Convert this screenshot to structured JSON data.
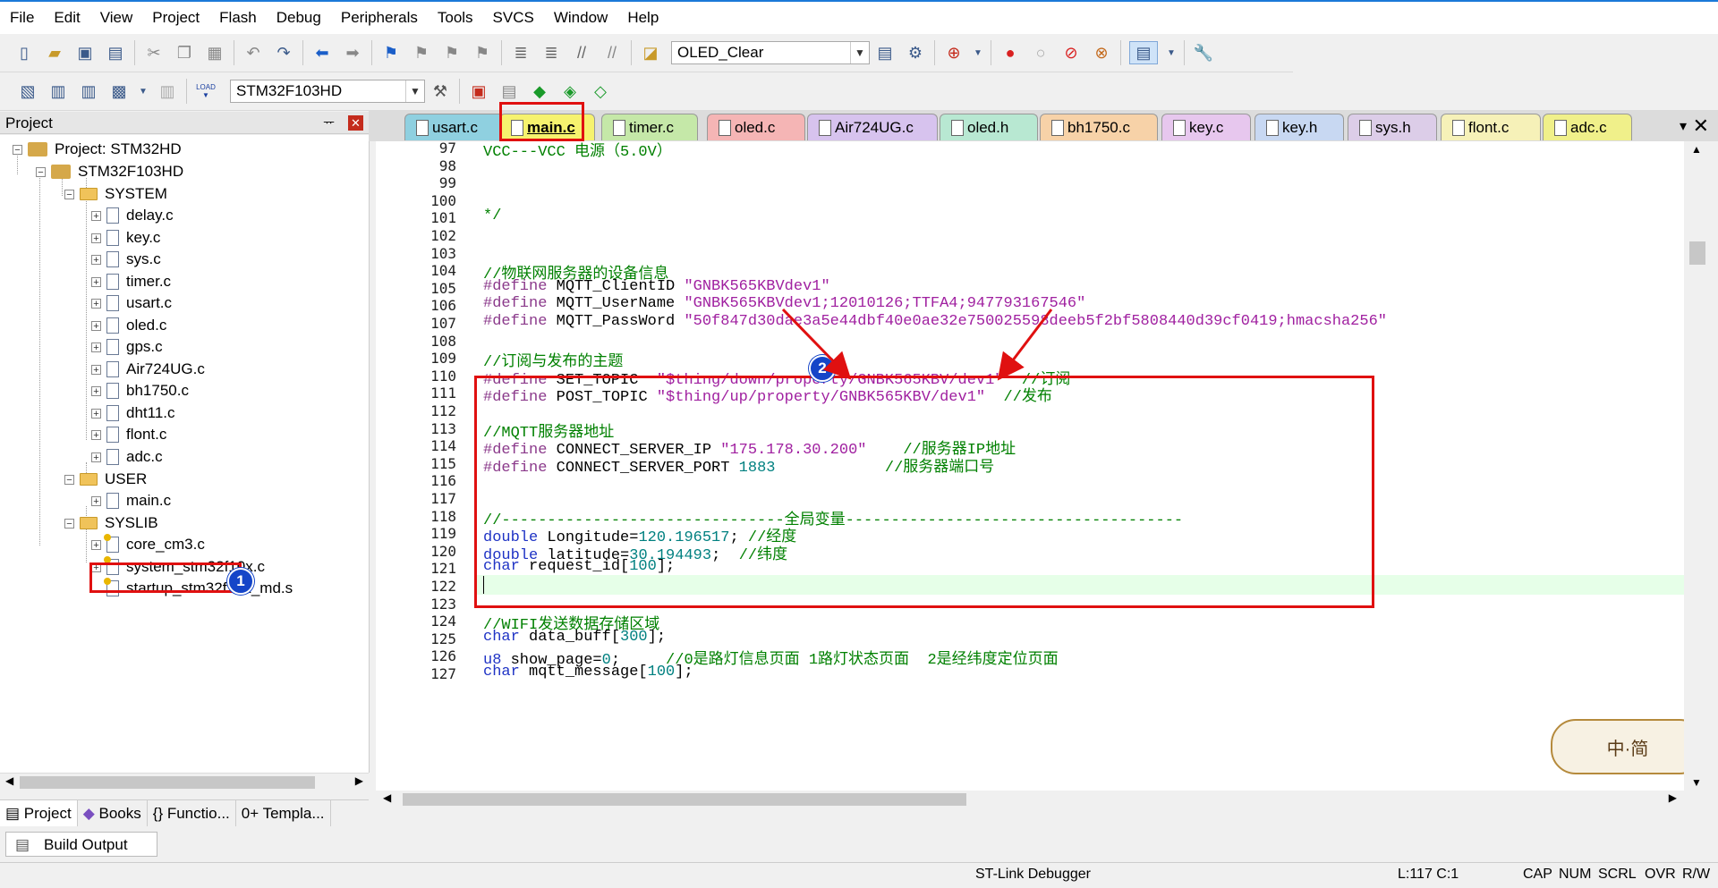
{
  "menu": [
    "File",
    "Edit",
    "View",
    "Project",
    "Flash",
    "Debug",
    "Peripherals",
    "Tools",
    "SVCS",
    "Window",
    "Help"
  ],
  "toolbar": {
    "target_combo": "OLED_Clear",
    "device_combo": "STM32F103HD",
    "load_label": "LOAD"
  },
  "project_panel": {
    "title": "Project",
    "pin": "ᅲ",
    "root": "Project: STM32HD",
    "target": "STM32F103HD",
    "groups": [
      {
        "name": "SYSTEM",
        "files": [
          "delay.c",
          "key.c",
          "sys.c",
          "timer.c",
          "usart.c",
          "oled.c",
          "gps.c",
          "Air724UG.c",
          "bh1750.c",
          "dht11.c",
          "flont.c",
          "adc.c"
        ]
      },
      {
        "name": "USER",
        "files": [
          "main.c"
        ]
      },
      {
        "name": "SYSLIB",
        "files": [
          "core_cm3.c",
          "system_stm32f10x.c",
          "startup_stm32f10x_md.s"
        ]
      }
    ],
    "tabs": [
      "Project",
      "Books",
      "{} Functio...",
      "0+ Templa..."
    ]
  },
  "editor_tabs": [
    {
      "label": "usart.c",
      "color": "#8fd0e0"
    },
    {
      "label": "main.c",
      "color": "#f6f26e"
    },
    {
      "label": "timer.c",
      "color": "#c5e8a8"
    },
    {
      "label": "oled.c",
      "color": "#f5b5b5"
    },
    {
      "label": "Air724UG.c",
      "color": "#d7c3ee"
    },
    {
      "label": "oled.h",
      "color": "#b8e8d2"
    },
    {
      "label": "bh1750.c",
      "color": "#f7d2a8"
    },
    {
      "label": "key.c",
      "color": "#e7c7ee"
    },
    {
      "label": "key.h",
      "color": "#c8d8f2"
    },
    {
      "label": "sys.h",
      "color": "#dccde8"
    },
    {
      "label": "flont.c",
      "color": "#f6f1b8"
    },
    {
      "label": "adc.c",
      "color": "#f0f08a"
    }
  ],
  "code_lines": [
    {
      "n": "97",
      "parts": [
        {
          "c": "cm",
          "t": "VCC---VCC 电源（5.0V）"
        }
      ]
    },
    {
      "n": "98",
      "parts": []
    },
    {
      "n": "99",
      "parts": []
    },
    {
      "n": "100",
      "parts": []
    },
    {
      "n": "101",
      "parts": [
        {
          "c": "cm",
          "t": "*/"
        }
      ]
    },
    {
      "n": "102",
      "parts": []
    },
    {
      "n": "103",
      "parts": []
    },
    {
      "n": "104",
      "parts": [
        {
          "c": "cm",
          "t": "//物联网服务器的设备信息"
        }
      ]
    },
    {
      "n": "105",
      "parts": [
        {
          "c": "pp",
          "t": "#define"
        },
        {
          "c": "",
          "t": " MQTT_ClientID "
        },
        {
          "c": "st",
          "t": "\"GNBK565KBVdev1\""
        }
      ]
    },
    {
      "n": "106",
      "parts": [
        {
          "c": "pp",
          "t": "#define"
        },
        {
          "c": "",
          "t": " MQTT_UserName "
        },
        {
          "c": "st",
          "t": "\"GNBK565KBVdev1;12010126;TTFA4;947793167546\""
        }
      ]
    },
    {
      "n": "107",
      "parts": [
        {
          "c": "pp",
          "t": "#define"
        },
        {
          "c": "",
          "t": " MQTT_PassWord "
        },
        {
          "c": "st",
          "t": "\"50f847d30dae3a5e44dbf40e0ae32e750025598deeb5f2bf5808440d39cf0419;hmacsha256\""
        }
      ]
    },
    {
      "n": "108",
      "parts": []
    },
    {
      "n": "109",
      "parts": [
        {
          "c": "cm",
          "t": "//订阅与发布的主题"
        }
      ]
    },
    {
      "n": "110",
      "parts": [
        {
          "c": "pp",
          "t": "#define"
        },
        {
          "c": "",
          "t": " SET_TOPIC  "
        },
        {
          "c": "st",
          "t": "\"$thing/down/property/GNBK565KBV/dev1\""
        },
        {
          "c": "",
          "t": "  "
        },
        {
          "c": "cm",
          "t": "//订阅"
        }
      ]
    },
    {
      "n": "111",
      "parts": [
        {
          "c": "pp",
          "t": "#define"
        },
        {
          "c": "",
          "t": " POST_TOPIC "
        },
        {
          "c": "st",
          "t": "\"$thing/up/property/GNBK565KBV/dev1\""
        },
        {
          "c": "",
          "t": "  "
        },
        {
          "c": "cm",
          "t": "//发布"
        }
      ]
    },
    {
      "n": "112",
      "parts": []
    },
    {
      "n": "113",
      "parts": [
        {
          "c": "cm",
          "t": "//MQTT服务器地址"
        }
      ]
    },
    {
      "n": "114",
      "parts": [
        {
          "c": "pp",
          "t": "#define"
        },
        {
          "c": "",
          "t": " CONNECT_SERVER_IP "
        },
        {
          "c": "st",
          "t": "\"175.178.30.200\""
        },
        {
          "c": "",
          "t": "    "
        },
        {
          "c": "cm",
          "t": "//服务器IP地址"
        }
      ]
    },
    {
      "n": "115",
      "parts": [
        {
          "c": "pp",
          "t": "#define"
        },
        {
          "c": "",
          "t": " CONNECT_SERVER_PORT "
        },
        {
          "c": "nm",
          "t": "1883"
        },
        {
          "c": "",
          "t": "            "
        },
        {
          "c": "cm",
          "t": "//服务器端口号"
        }
      ]
    },
    {
      "n": "116",
      "parts": []
    },
    {
      "n": "117",
      "parts": []
    },
    {
      "n": "118",
      "parts": [
        {
          "c": "cm",
          "t": "//-------------------------------全局变量-------------------------------------"
        }
      ]
    },
    {
      "n": "119",
      "parts": [
        {
          "c": "kw",
          "t": "double"
        },
        {
          "c": "",
          "t": " Longitude="
        },
        {
          "c": "nm",
          "t": "120.196517"
        },
        {
          "c": "",
          "t": "; "
        },
        {
          "c": "cm",
          "t": "//经度"
        }
      ]
    },
    {
      "n": "120",
      "parts": [
        {
          "c": "kw",
          "t": "double"
        },
        {
          "c": "",
          "t": " latitude="
        },
        {
          "c": "nm",
          "t": "30.194493"
        },
        {
          "c": "",
          "t": ";  "
        },
        {
          "c": "cm",
          "t": "//纬度"
        }
      ]
    },
    {
      "n": "121",
      "parts": [
        {
          "c": "kw",
          "t": "char"
        },
        {
          "c": "",
          "t": " request_id["
        },
        {
          "c": "nm",
          "t": "100"
        },
        {
          "c": "",
          "t": "];"
        }
      ]
    },
    {
      "n": "122",
      "parts": []
    },
    {
      "n": "123",
      "parts": []
    },
    {
      "n": "124",
      "parts": [
        {
          "c": "cm",
          "t": "//WIFI发送数据存储区域"
        }
      ]
    },
    {
      "n": "125",
      "parts": [
        {
          "c": "kw",
          "t": "char"
        },
        {
          "c": "",
          "t": " data_buff["
        },
        {
          "c": "nm",
          "t": "300"
        },
        {
          "c": "",
          "t": "];"
        }
      ]
    },
    {
      "n": "126",
      "parts": [
        {
          "c": "kw",
          "t": "u8"
        },
        {
          "c": "",
          "t": " show_page="
        },
        {
          "c": "nm",
          "t": "0"
        },
        {
          "c": "",
          "t": ";     "
        },
        {
          "c": "cm",
          "t": "//0是路灯信息页面 1路灯状态页面  2是经纬度定位页面"
        }
      ]
    },
    {
      "n": "127",
      "parts": [
        {
          "c": "kw",
          "t": "char"
        },
        {
          "c": "",
          "t": " mqtt_message["
        },
        {
          "c": "nm",
          "t": "100"
        },
        {
          "c": "",
          "t": "];"
        }
      ]
    }
  ],
  "annotations": {
    "badge1": "1",
    "badge2": "2"
  },
  "watermark": "中·简",
  "build": {
    "tab": "Build Output"
  },
  "status": {
    "debugger": "ST-Link Debugger",
    "position": "L:117 C:1",
    "flags": [
      "CAP",
      "NUM",
      "SCRL",
      "OVR",
      "R/W"
    ]
  }
}
